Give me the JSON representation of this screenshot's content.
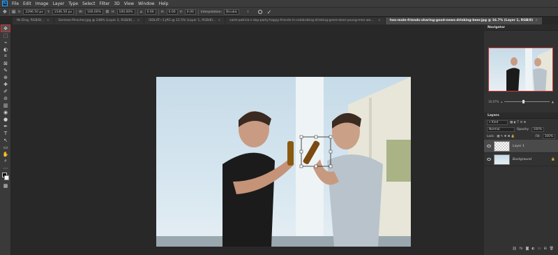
{
  "app": {
    "logo": "Ps"
  },
  "menu": [
    "File",
    "Edit",
    "Image",
    "Layer",
    "Type",
    "Select",
    "Filter",
    "3D",
    "View",
    "Window",
    "Help"
  ],
  "options": {
    "x_label": "X:",
    "x_value": "2296.50 px",
    "y_label": "Y:",
    "y_value": "1546.50 px",
    "w_label": "W:",
    "w_value": "100.00%",
    "h_label": "H:",
    "h_value": "100.00%",
    "angle_value": "0.00",
    "hskew_label": "H:",
    "hskew_value": "0.00",
    "vskew_label": "V:",
    "vskew_value": "0.00",
    "interp_label": "Interpolation:",
    "interp_value": "Bicubic"
  },
  "tabs": [
    {
      "label": "IN (Dvg, RGB/8)...",
      "active": false
    },
    {
      "label": "German-Pinscher.jpg @ 248% (Layer 2, RGB/8)...",
      "active": false
    },
    {
      "label": "ISOLAT~1.JPG @ 12.5% (Layer 1, RGB/8)...",
      "active": false
    },
    {
      "label": "saint-patrick-s-day-party-happy-friends-in-celebrating-drinking-green-beer-young-men-women-wearing-green-hats-pub-interior.jpg",
      "active": false
    },
    {
      "label": "two-male-friends-sharing-good-news-drinking-beer.jpg @ 16.7% (Layer 1, RGB/8)",
      "active": true
    }
  ],
  "tab_close": "×",
  "tools": [
    "✥",
    "⬚",
    "⌁",
    "◐",
    "⌗",
    "⊠",
    "✎",
    "⊕",
    "✚",
    "✐",
    "⊘",
    "▥",
    "◉",
    "●",
    "✒",
    "T",
    "↖",
    "▭",
    "✋",
    "⌕",
    "⋯",
    "▦"
  ],
  "navigator": {
    "title": "Navigator",
    "zoom": "16.67%"
  },
  "layers": {
    "title": "Layers",
    "kind_label": "Kind",
    "blend_mode": "Normal",
    "opacity_label": "Opacity:",
    "opacity_value": "100%",
    "lock_label": "Lock:",
    "fill_label": "Fill:",
    "fill_value": "100%",
    "items": [
      {
        "name": "Layer 1",
        "selected": true
      },
      {
        "name": "Background",
        "selected": false
      }
    ]
  }
}
